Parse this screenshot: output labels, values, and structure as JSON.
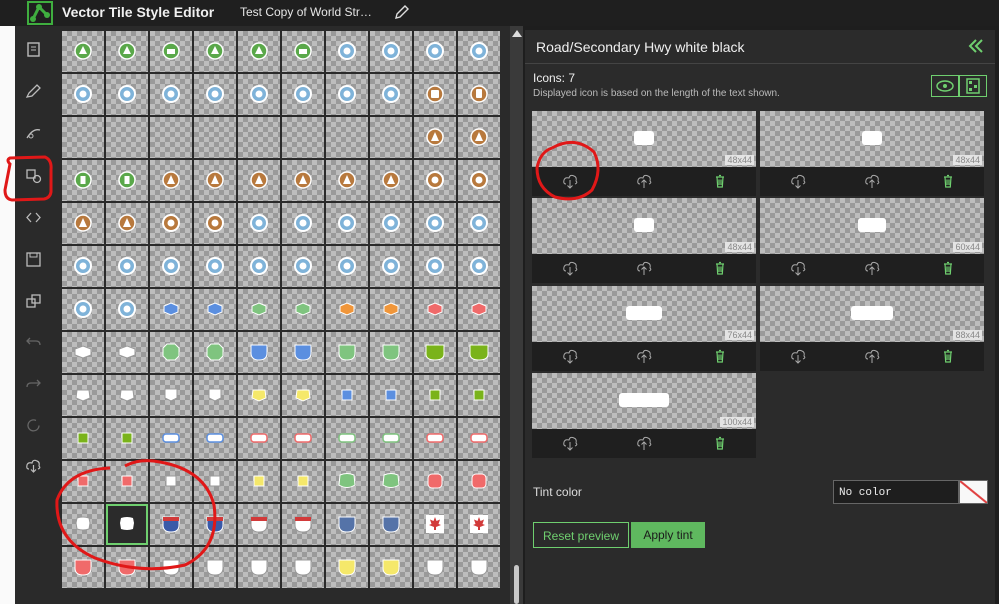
{
  "app": {
    "title": "Vector Tile Style Editor",
    "document_title": "Test Copy of World Str…"
  },
  "toolbar": {
    "items": [
      {
        "name": "layers-icon"
      },
      {
        "name": "quick-edit-icon"
      },
      {
        "name": "edit-layer-style-icon"
      },
      {
        "name": "sprite-icons-icon"
      },
      {
        "name": "json-code-icon"
      },
      {
        "name": "save-icon"
      },
      {
        "name": "copy-layers-icon"
      },
      {
        "name": "undo-icon"
      },
      {
        "name": "redo-icon"
      },
      {
        "name": "reset-icon"
      },
      {
        "name": "download-icon"
      }
    ]
  },
  "sprite_grid": {
    "rows": [
      [
        "tree-circle",
        "tree-circle",
        "animal-circle",
        "tree-circle",
        "tree-circle",
        "animal-circle",
        "dot-circle",
        "dot-circle",
        "dot-circle",
        "dot-circle"
      ],
      [
        "dot-circle",
        "dot-circle",
        "dot-circle",
        "dot-circle",
        "dot-circle",
        "dot-circle",
        "dot-circle",
        "dot-circle",
        "bus-circle",
        "train-circle"
      ],
      [
        "empty",
        "empty",
        "empty",
        "empty",
        "empty",
        "empty",
        "empty",
        "empty",
        "tent-circle",
        "tent-circle"
      ],
      [
        "door-circle",
        "door-circle",
        "tent-circle",
        "tent-circle",
        "tent-circle",
        "tent-circle",
        "tent-circle",
        "tent-circle",
        "brown-dot-circle",
        "brown-dot-circle"
      ],
      [
        "tent-circle",
        "tent-circle",
        "brown-dot-circle",
        "brown-dot-circle",
        "dot-circle",
        "dot-circle",
        "dot-circle",
        "dot-circle",
        "dot-circle",
        "dot-circle"
      ],
      [
        "dot-circle",
        "dot-circle",
        "dot-circle",
        "dot-circle",
        "dot-circle",
        "dot-circle",
        "dot-circle",
        "dot-circle",
        "dot-circle",
        "dot-circle"
      ],
      [
        "dot-circle",
        "dot-circle",
        "blue-hex",
        "blue-hex",
        "green-hex",
        "green-hex",
        "orange-hex",
        "orange-hex",
        "red-hex",
        "red-hex"
      ],
      [
        "white-hex",
        "white-hex",
        "green-octagon",
        "green-octagon",
        "blue-shield",
        "blue-shield",
        "green-shield",
        "green-shield",
        "olive-shield",
        "olive-shield"
      ],
      [
        "white-pentagon",
        "white-pentagon",
        "white-rect-shield",
        "white-rect-shield",
        "yellow-pentagon",
        "yellow-pentagon",
        "blue-square",
        "blue-square",
        "green-square",
        "green-square"
      ],
      [
        "green-square",
        "green-square",
        "blue-oval-rect",
        "blue-oval-rect",
        "red-oval-rect",
        "red-oval-rect",
        "green-oval-rect",
        "green-oval-rect",
        "red-oval-rect",
        "red-oval-rect"
      ],
      [
        "red-square",
        "red-square",
        "white-square",
        "white-square",
        "yellow-square",
        "yellow-square",
        "green-badge",
        "green-badge",
        "red-rounded",
        "red-rounded"
      ],
      [
        "white-badge",
        "white-badge-selected",
        "interstate",
        "interstate",
        "red-top-shield",
        "red-top-shield",
        "navy-shield",
        "navy-shield",
        "maple-leaf",
        "maple-leaf"
      ],
      [
        "red-shield",
        "red-shield",
        "white-shield",
        "white-shield",
        "white-shield",
        "white-shield",
        "yellow-shield",
        "yellow-shield",
        "white-shield",
        "white-shield"
      ]
    ]
  },
  "panel": {
    "title": "Road/Secondary Hwy white black",
    "icons_count": "Icons: 7",
    "note": "Displayed icon is based on the length of the text shown.",
    "view_buttons": [
      {
        "name": "eye-icon"
      },
      {
        "name": "qr-grid-icon"
      }
    ],
    "cards": [
      {
        "size": "48x44",
        "shape_width": 20
      },
      {
        "size": "48x44",
        "shape_width": 20
      },
      {
        "size": "48x44",
        "shape_width": 20
      },
      {
        "size": "60x44",
        "shape_width": 28
      },
      {
        "size": "76x44",
        "shape_width": 36
      },
      {
        "size": "88x44",
        "shape_width": 42
      },
      {
        "size": "100x44",
        "shape_width": 50
      }
    ],
    "tint_label": "Tint color",
    "tint_value": "No color",
    "reset_label": "Reset preview",
    "apply_label": "Apply tint"
  },
  "colors": {
    "accent_green": "#6fcf6f",
    "annotation_red": "#e01818",
    "panel_bg": "#2b2b2b"
  }
}
